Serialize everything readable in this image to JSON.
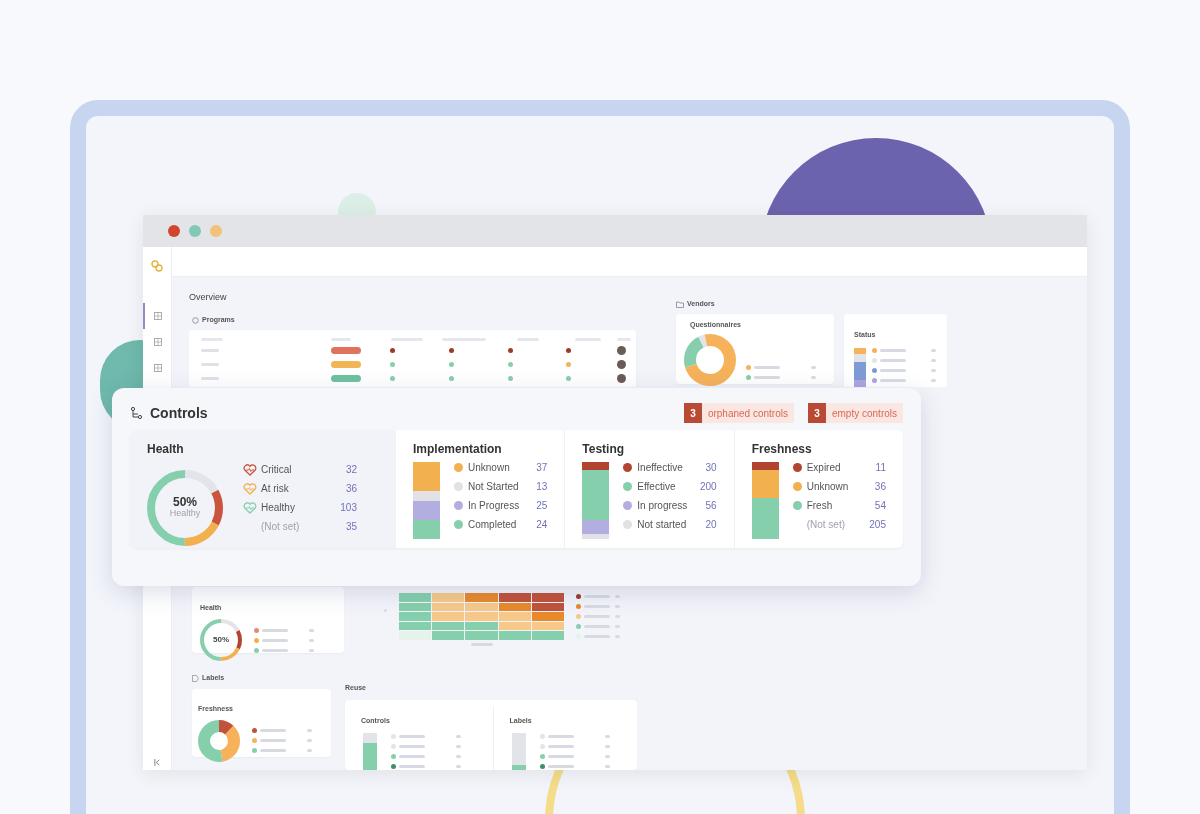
{
  "window": {
    "traffic_lights": [
      {
        "color": "#d2452c"
      },
      {
        "color": "#7fc9b5"
      },
      {
        "color": "#f3c27a"
      }
    ]
  },
  "sidebar": {
    "items": [
      {
        "selected": true
      },
      {
        "selected": false
      },
      {
        "selected": false
      }
    ]
  },
  "overview": {
    "title": "Overview"
  },
  "programs": {
    "title": "Programs",
    "rows": [
      {
        "status": {
          "color": "#e0735c"
        },
        "dots": [
          {
            "color": "#9c3b2a"
          },
          {
            "color": "#9c3b2a"
          },
          {
            "color": "#9c3b2a"
          },
          {
            "color": "#9c3b2a"
          }
        ]
      },
      {
        "status": {
          "color": "#f2b455"
        },
        "dots": [
          {
            "color": "#86cfad"
          },
          {
            "color": "#86cfad"
          },
          {
            "color": "#86cfad"
          },
          {
            "color": "#f2b455"
          }
        ]
      },
      {
        "status": {
          "color": "#6fc29f"
        },
        "dots": [
          {
            "color": "#86cfad"
          },
          {
            "color": "#86cfad"
          },
          {
            "color": "#86cfad"
          },
          {
            "color": "#86cfad"
          }
        ]
      }
    ]
  },
  "vendors": {
    "title": "Vendors",
    "questionnaires": {
      "title": "Questionnaires",
      "legend": [
        {
          "color": "#f5b25a"
        },
        {
          "color": "#86cfad"
        }
      ]
    },
    "status": {
      "title": "Status",
      "legend": [
        {
          "color": "#f5b25a"
        },
        {
          "color": "#e3e3ea"
        },
        {
          "color": "#7f9bd6"
        },
        {
          "color": "#a9a6e0"
        }
      ]
    }
  },
  "controls": {
    "title": "Controls",
    "badges": [
      {
        "count": "3",
        "label": "orphaned controls"
      },
      {
        "count": "3",
        "label": "empty controls"
      }
    ],
    "health": {
      "title": "Health",
      "percent": "50%",
      "caption": "Healthy",
      "items": [
        {
          "label": "Critical",
          "value": "32",
          "color": "#c9553d"
        },
        {
          "label": "At risk",
          "value": "36",
          "color": "#f2b04f"
        },
        {
          "label": "Healthy",
          "value": "103",
          "color": "#86cfad"
        },
        {
          "label": "(Not set)",
          "value": "35",
          "color": "#e3e3ea"
        }
      ]
    },
    "groups": [
      {
        "title": "Implementation",
        "items": [
          {
            "label": "Unknown",
            "value": "37",
            "color": "#f2b04f"
          },
          {
            "label": "Not Started",
            "value": "13",
            "color": "#e1e1e6"
          },
          {
            "label": "In Progress",
            "value": "25",
            "color": "#b3aee0"
          },
          {
            "label": "Completed",
            "value": "24",
            "color": "#86cfad"
          }
        ]
      },
      {
        "title": "Testing",
        "items": [
          {
            "label": "Ineffective",
            "value": "30",
            "color": "#b2452f"
          },
          {
            "label": "Effective",
            "value": "200",
            "color": "#86cfad"
          },
          {
            "label": "In progress",
            "value": "56",
            "color": "#b3aee0"
          },
          {
            "label": "Not started",
            "value": "20",
            "color": "#e1e1e6"
          }
        ]
      },
      {
        "title": "Freshness",
        "items": [
          {
            "label": "Expired",
            "value": "11",
            "color": "#b2452f"
          },
          {
            "label": "Unknown",
            "value": "36",
            "color": "#f2b04f"
          },
          {
            "label": "Fresh",
            "value": "54",
            "color": "#86cfad"
          },
          {
            "label": "(Not set)",
            "value": "205"
          }
        ]
      }
    ]
  },
  "risks": {
    "health": {
      "title": "Health",
      "percent": "50%",
      "segments": [
        {
          "color": "#e3e3ea"
        },
        {
          "color": "#b2452f"
        },
        {
          "color": "#f2b04f"
        },
        {
          "color": "#86cfad"
        }
      ],
      "legend": [
        {
          "color": "#e08a70"
        },
        {
          "color": "#f2b04f"
        },
        {
          "color": "#86cfad"
        }
      ]
    },
    "heatmap": [
      {
        "cells": [
          {
            "color": "#86cfad"
          },
          {
            "color": "#f6c98a"
          },
          {
            "color": "#e8892a"
          },
          {
            "color": "#c0533a"
          },
          {
            "color": "#c0533a"
          }
        ]
      },
      {
        "cells": [
          {
            "color": "#86cfad"
          },
          {
            "color": "#f6c98a"
          },
          {
            "color": "#f6c98a"
          },
          {
            "color": "#e8892a"
          },
          {
            "color": "#c0533a"
          }
        ]
      },
      {
        "cells": [
          {
            "color": "#86cfad"
          },
          {
            "color": "#f6c98a"
          },
          {
            "color": "#f6c98a"
          },
          {
            "color": "#f6c98a"
          },
          {
            "color": "#e8892a"
          }
        ]
      },
      {
        "cells": [
          {
            "color": "#86cfad"
          },
          {
            "color": "#86cfad"
          },
          {
            "color": "#86cfad"
          },
          {
            "color": "#f6c98a"
          },
          {
            "color": "#f6c98a"
          }
        ]
      },
      {
        "cells": [
          {
            "color": "#e5f3ec"
          },
          {
            "color": "#86cfad"
          },
          {
            "color": "#86cfad"
          },
          {
            "color": "#86cfad"
          },
          {
            "color": "#86cfad"
          }
        ]
      }
    ],
    "legend": [
      {
        "color": "#9c3b2a"
      },
      {
        "color": "#e8892a"
      },
      {
        "color": "#f6c98a"
      },
      {
        "color": "#86cfad"
      },
      {
        "color": "#e5f3ec"
      }
    ]
  },
  "labels": {
    "title": "Labels",
    "freshness": {
      "title": "Freshness",
      "segments": [
        {
          "color": "#c0533a"
        },
        {
          "color": "#f5b25a"
        },
        {
          "color": "#86cfad"
        }
      ],
      "legend": [
        {
          "color": "#c0533a"
        },
        {
          "color": "#f5b25a"
        },
        {
          "color": "#86cfad"
        }
      ]
    }
  },
  "reuse": {
    "title": "Reuse",
    "cards": [
      {
        "title": "Controls",
        "legend": [
          {
            "color": "#e3e3ea"
          },
          {
            "color": "#e3e3ea"
          },
          {
            "color": "#86cfad"
          },
          {
            "color": "#3f8f6a"
          }
        ]
      },
      {
        "title": "Labels",
        "legend": [
          {
            "color": "#e3e3ea"
          },
          {
            "color": "#e3e3ea"
          },
          {
            "color": "#86cfad"
          },
          {
            "color": "#3f8f6a"
          }
        ]
      }
    ]
  }
}
